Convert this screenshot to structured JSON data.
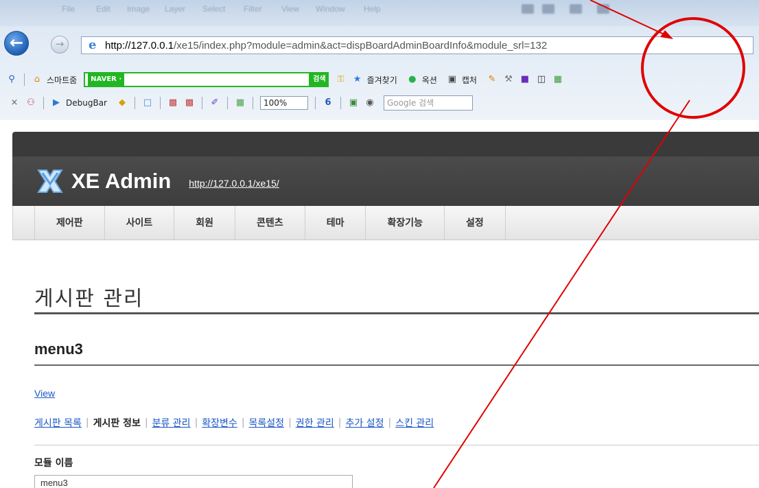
{
  "browser": {
    "menu": [
      "File",
      "Edit",
      "Image",
      "Layer",
      "Select",
      "Filter",
      "View",
      "Window",
      "Help"
    ],
    "url_host": "http://127.0.0.1",
    "url_path": "/xe15/index.php?module=admin&act=dispBoardAdminBoardInfo&module_srl=132",
    "toolbar1": {
      "smart_label": "스마트줌",
      "naver_logo": "NAVER ·",
      "naver_search_btn": "검색",
      "favorites": "즐겨찾기",
      "options": "옥션",
      "capture": "캡처"
    },
    "toolbar2": {
      "debugbar": "DebugBar",
      "zoom": "100%",
      "google_placeholder": "Google 검색"
    }
  },
  "admin": {
    "title": "XE Admin",
    "site_url": "http://127.0.0.1/xe15/",
    "gnb": [
      "제어판",
      "사이트",
      "회원",
      "콘텐츠",
      "테마",
      "확장기능",
      "설정"
    ]
  },
  "page": {
    "title": "게시판 관리",
    "module_name": "menu3",
    "view_link": "View",
    "subnav": [
      {
        "label": "게시판 목록",
        "active": false
      },
      {
        "label": "게시판 정보",
        "active": true
      },
      {
        "label": "분류 관리",
        "active": false
      },
      {
        "label": "확장변수",
        "active": false
      },
      {
        "label": "목록설정",
        "active": false
      },
      {
        "label": "권한 관리",
        "active": false
      },
      {
        "label": "추가 설정",
        "active": false
      },
      {
        "label": "스킨 관리",
        "active": false
      }
    ],
    "field_label": "모듈 이름",
    "field_value": "menu3"
  },
  "colors": {
    "annotation": "#e00000",
    "link": "#1a55c7",
    "admin_header": "#3d3d3d",
    "naver_green": "#23b623"
  }
}
